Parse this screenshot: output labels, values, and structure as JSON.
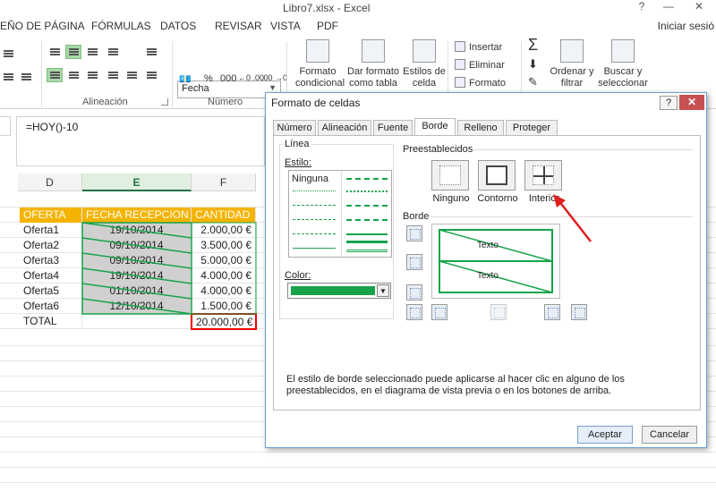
{
  "window": {
    "title": "Libro7.xlsx - Excel",
    "help": "?",
    "minimize": "—",
    "close": "✕"
  },
  "ribbon_tabs": [
    "EÑO DE PÁGINA",
    "FÓRMULAS",
    "DATOS",
    "REVISAR",
    "VISTA",
    "PDF"
  ],
  "signin": "Iniciar sesió",
  "ribbon": {
    "alignment_label": "Alineación",
    "number_label": "Número",
    "number_format": "Fecha",
    "buttons": {
      "conditional": "Formato condicional",
      "as_table": "Dar formato como tabla",
      "cell_styles": "Estilos de celda",
      "insert": "Insertar",
      "delete": "Eliminar",
      "format": "Formato",
      "sort_filter": "Ordenar y filtrar",
      "find_select": "Buscar y seleccionar",
      "pct": "%",
      "thousands": "000",
      "inc_dec": "←0 .00",
      "dec_dec": ".00 →0"
    }
  },
  "formula": "=HOY()-10",
  "columns": [
    "D",
    "E",
    "F"
  ],
  "sheet": {
    "header": [
      "OFERTA",
      "FECHA RECEPCION",
      "CANTIDAD"
    ],
    "rows": [
      [
        "Oferta1",
        "19/10/2014",
        "2.000,00 €"
      ],
      [
        "Oferta2",
        "09/10/2014",
        "3.500,00 €"
      ],
      [
        "Oferta3",
        "09/10/2014",
        "5.000,00 €"
      ],
      [
        "Oferta4",
        "19/10/2014",
        "4.000,00 €"
      ],
      [
        "Oferta5",
        "01/10/2014",
        "4.000,00 €"
      ],
      [
        "Oferta6",
        "12/10/2014",
        "1.500,00 €"
      ]
    ],
    "total_label": "TOTAL",
    "total_value": "20.000,00 €"
  },
  "dialog": {
    "title": "Formato de celdas",
    "tabs": [
      "Número",
      "Alineación",
      "Fuente",
      "Borde",
      "Relleno",
      "Proteger"
    ],
    "active_tab": "Borde",
    "line_group": "Línea",
    "style_label": "Estilo:",
    "style_none": "Ninguna",
    "color_label": "Color:",
    "color_value": "#16a34a",
    "presets_group": "Preestablecidos",
    "presets": [
      "Ninguno",
      "Contorno",
      "Interior"
    ],
    "border_group": "Borde",
    "preview_text": "Texto",
    "description": "El estilo de borde seleccionado puede aplicarse al hacer clic en alguno de los preestablecidos, en el diagrama de vista previa o en los botones de arriba.",
    "ok": "Aceptar",
    "cancel": "Cancelar"
  },
  "colors": {
    "accent_green": "#16a34a",
    "header_orange": "#f4b400",
    "annotation_red": "#e02020"
  }
}
